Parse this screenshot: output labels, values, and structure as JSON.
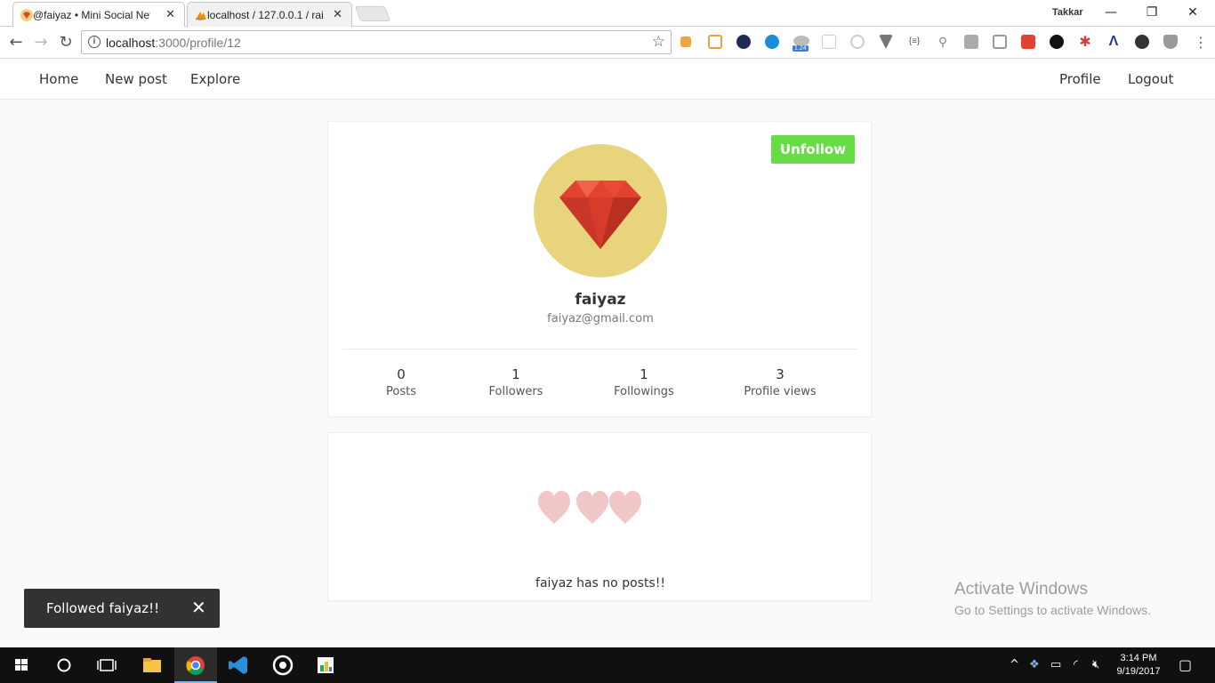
{
  "browser": {
    "tabs": [
      {
        "title": "@faiyaz • Mini Social Net",
        "active": true
      },
      {
        "title": "localhost / 127.0.0.1 / rai",
        "active": false
      }
    ],
    "user": "Takkar",
    "url_host": "localhost",
    "url_path": ":3000/profile/12",
    "ext_badge": "1.24"
  },
  "nav": {
    "left": [
      "Home",
      "New post",
      "Explore"
    ],
    "right": [
      "Profile",
      "Logout"
    ]
  },
  "profile": {
    "action_label": "Unfollow",
    "username": "faiyaz",
    "email": "faiyaz@gmail.com",
    "stats": [
      {
        "value": "0",
        "label": "Posts"
      },
      {
        "value": "1",
        "label": "Followers"
      },
      {
        "value": "1",
        "label": "Followings"
      },
      {
        "value": "3",
        "label": "Profile views"
      }
    ]
  },
  "posts": {
    "empty_message": "faiyaz has no posts!!"
  },
  "toast": {
    "message": "Followed faiyaz!!",
    "close": "✕"
  },
  "watermark": {
    "title": "Activate Windows",
    "subtitle": "Go to Settings to activate Windows."
  },
  "taskbar": {
    "time": "3:14 PM",
    "date": "9/19/2017"
  },
  "colors": {
    "accent_button": "#66dd44",
    "avatar_bg": "#e9d47e",
    "ruby": "#e0432f",
    "hearts": "#f0c6c6"
  }
}
